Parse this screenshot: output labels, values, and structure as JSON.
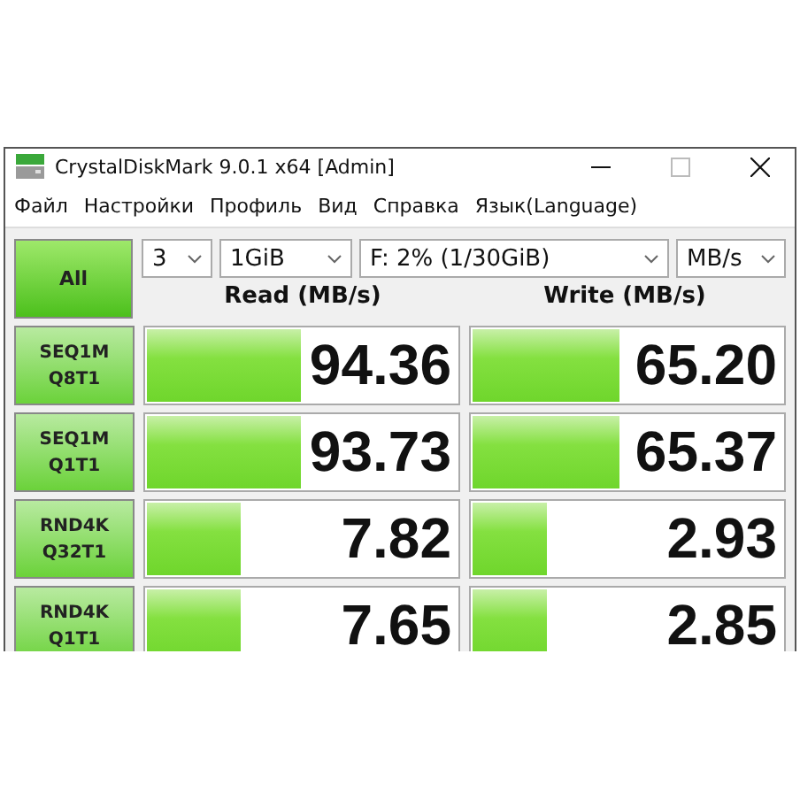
{
  "window": {
    "title": "CrystalDiskMark 9.0.1 x64 [Admin]"
  },
  "menu": [
    "Файл",
    "Настройки",
    "Профиль",
    "Вид",
    "Справка",
    "Язык(Language)"
  ],
  "all_button": "All",
  "selectors": [
    {
      "value": "3"
    },
    {
      "value": "1GiB"
    },
    {
      "value": "F: 2% (1/30GiB)"
    },
    {
      "value": "MB/s"
    }
  ],
  "columns": [
    "Read (MB/s)",
    "Write (MB/s)"
  ],
  "rows": [
    {
      "test": [
        "SEQ1M",
        "Q8T1"
      ],
      "read": {
        "value": "94.36",
        "level": 0.49
      },
      "write": {
        "value": "65.20",
        "level": 0.47
      }
    },
    {
      "test": [
        "SEQ1M",
        "Q1T1"
      ],
      "read": {
        "value": "93.73",
        "level": 0.49
      },
      "write": {
        "value": "65.37",
        "level": 0.47
      }
    },
    {
      "test": [
        "RND4K",
        "Q32T1"
      ],
      "read": {
        "value": "7.82",
        "level": 0.3
      },
      "write": {
        "value": "2.93",
        "level": 0.24
      }
    },
    {
      "test": [
        "RND4K",
        "Q1T1"
      ],
      "read": {
        "value": "7.65",
        "level": 0.3
      },
      "write": {
        "value": "2.85",
        "level": 0.24
      }
    }
  ]
}
